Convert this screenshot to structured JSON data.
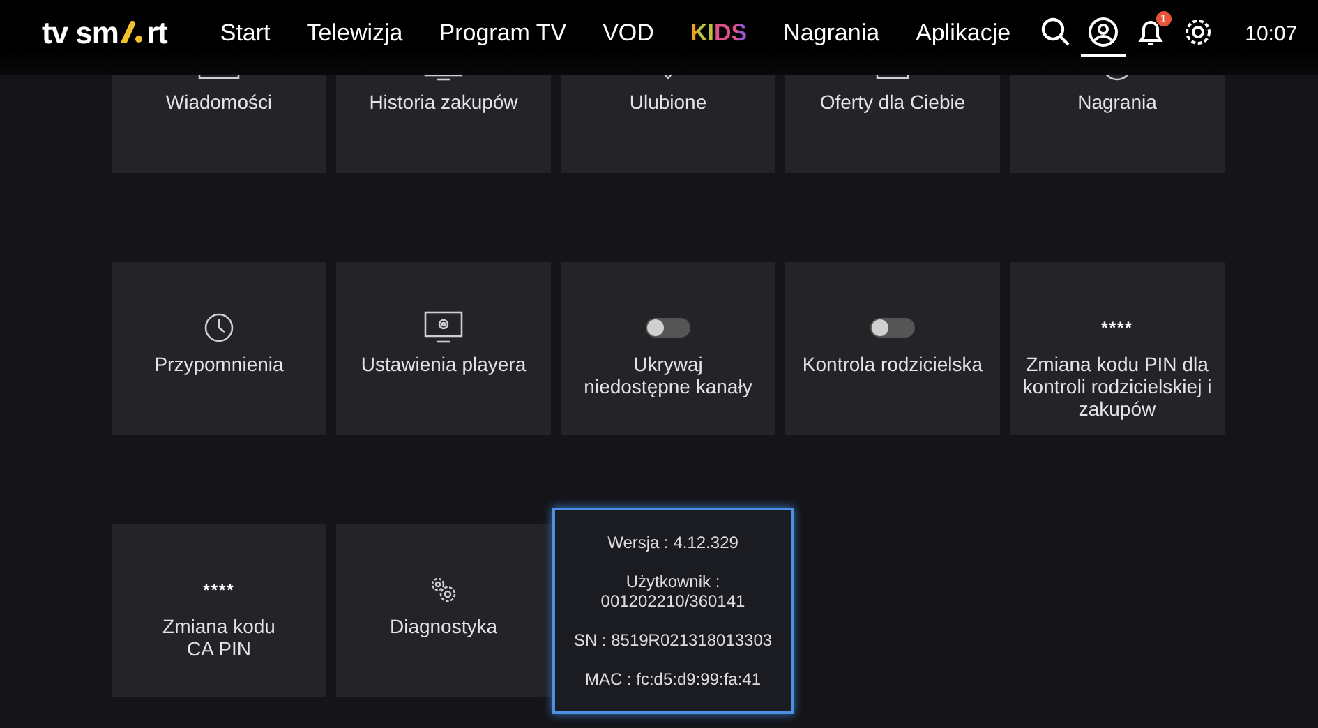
{
  "header": {
    "logo": {
      "left": "tv sm",
      "right": "rt"
    },
    "nav": [
      {
        "label": "Start",
        "kind": "plain"
      },
      {
        "label": "Telewizja",
        "kind": "plain"
      },
      {
        "label": "Program TV",
        "kind": "plain"
      },
      {
        "label": "VOD",
        "kind": "plain"
      },
      {
        "label": "KIDS",
        "kind": "kids"
      },
      {
        "label": "Nagrania",
        "kind": "plain"
      },
      {
        "label": "Aplikacje",
        "kind": "plain"
      }
    ],
    "icons": [
      {
        "kind": "search",
        "selected": false
      },
      {
        "kind": "account",
        "selected": true
      },
      {
        "kind": "bell",
        "selected": false,
        "badge": "1"
      },
      {
        "kind": "settings",
        "selected": false
      }
    ],
    "clock": "10:07"
  },
  "tiles": [
    {
      "label": "Wiadomości",
      "kind": "icon"
    },
    {
      "label": "Historia zakupów",
      "kind": "icon"
    },
    {
      "label": "Ulubione",
      "kind": "icon"
    },
    {
      "label": "Oferty dla Ciebie",
      "kind": "icon"
    },
    {
      "label": "Nagrania",
      "kind": "icon"
    },
    {
      "label": "Przypomnienia",
      "kind": "icon"
    },
    {
      "label": "Ustawienia playera",
      "kind": "icon"
    },
    {
      "label": "Ukrywaj\nniedostępne kanały",
      "kind": "toggle",
      "on": false
    },
    {
      "label": "Kontrola rodzicielska",
      "kind": "toggle",
      "on": false
    },
    {
      "label": "Zmiana kodu PIN dla kontroli rodzicielskiej i zakupów",
      "kind": "pin",
      "mask": "****"
    },
    {
      "label": "Zmiana kodu\nCA PIN",
      "kind": "pin",
      "mask": "****"
    },
    {
      "label": "Diagnostyka",
      "kind": "icon"
    }
  ],
  "info_panel": {
    "lines": [
      "Wersja : 4.12.329",
      "Użytkownik :\n001202210/360141",
      "SN : 8519R021318013303",
      "MAC : fc:d5:d9:99:fa:41"
    ]
  }
}
